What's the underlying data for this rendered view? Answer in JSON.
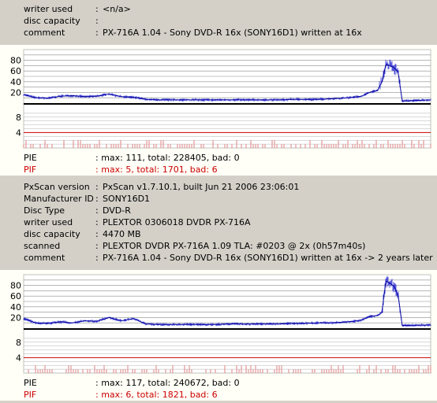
{
  "disc1": {
    "info": [
      {
        "label": "writer used",
        "value": "<n/a>"
      },
      {
        "label": "disc capacity",
        "value": ""
      },
      {
        "label": "comment",
        "value": "PX-716A 1.04 - Sony DVD-R 16x (SONY16D1) written at 16x"
      }
    ],
    "stats": {
      "pie_label": "PIE",
      "pie_value": ": max: 111, total: 228405, bad: 0",
      "pif_label": "PIF",
      "pif_value": ": max: 5, total: 1701, bad: 6"
    }
  },
  "disc2": {
    "info": [
      {
        "label": "PxScan version",
        "value": "PxScan v1.7.10.1, built Jun 21 2006 23:06:01"
      },
      {
        "label": "Manufacturer ID",
        "value": "SONY16D1"
      },
      {
        "label": "Disc Type",
        "value": "DVD-R"
      },
      {
        "label": "writer used",
        "value": "PLEXTOR 0306018 DVDR PX-716A"
      },
      {
        "label": "disc capacity",
        "value": "4470 MB"
      },
      {
        "label": "scanned",
        "value": "PLEXTOR DVDR PX-716A 1.09 TLA: #0203 @ 2x (0h57m40s)"
      },
      {
        "label": "comment",
        "value": "PX-716A 1.04 - Sony DVD-R 16x (SONY16D1) written at 16x -> 2 years later"
      }
    ],
    "stats": {
      "pie_label": "PIE",
      "pie_value": ": max: 117, total: 240672, bad: 0",
      "pif_label": "PIF",
      "pif_value": ": max: 6, total: 1821, bad: 6"
    }
  },
  "separator": ":",
  "colors": {
    "pie": "#2020d0",
    "pif": "#e08080",
    "pif_threshold": "#cc0000",
    "grid": "#8c8c8c"
  },
  "chart_data": [
    {
      "type": "area",
      "title": "",
      "pie": {
        "ylim": [
          0,
          100
        ],
        "yticks": [
          20,
          40,
          60,
          80
        ],
        "tick_labels": [
          "20",
          "40",
          "60",
          "80"
        ],
        "x": [
          0,
          0.03,
          0.06,
          0.09,
          0.12,
          0.15,
          0.18,
          0.21,
          0.24,
          0.27,
          0.3,
          0.33,
          0.36,
          0.39,
          0.42,
          0.45,
          0.48,
          0.51,
          0.54,
          0.57,
          0.6,
          0.63,
          0.66,
          0.69,
          0.72,
          0.75,
          0.78,
          0.81,
          0.83,
          0.85,
          0.87,
          0.88,
          0.89,
          0.9,
          0.91,
          0.92,
          0.93,
          1.0
        ],
        "y": [
          16,
          10,
          9,
          13,
          14,
          12,
          13,
          17,
          12,
          11,
          7,
          6,
          6,
          6,
          6,
          6,
          6,
          6,
          6,
          6,
          6,
          6,
          7,
          7,
          7,
          8,
          9,
          11,
          13,
          20,
          24,
          40,
          72,
          70,
          66,
          58,
          4,
          6
        ]
      },
      "pif": {
        "yticks": [
          4,
          8
        ],
        "tick_labels": [
          "4",
          "8"
        ],
        "threshold": 4,
        "typical": 1
      }
    },
    {
      "type": "area",
      "title": "",
      "pie": {
        "ylim": [
          0,
          100
        ],
        "yticks": [
          20,
          40,
          60,
          80
        ],
        "tick_labels": [
          "20",
          "40",
          "60",
          "80"
        ],
        "x": [
          0,
          0.03,
          0.06,
          0.09,
          0.12,
          0.15,
          0.18,
          0.21,
          0.24,
          0.27,
          0.3,
          0.33,
          0.36,
          0.39,
          0.42,
          0.45,
          0.48,
          0.51,
          0.54,
          0.57,
          0.6,
          0.63,
          0.66,
          0.69,
          0.72,
          0.75,
          0.78,
          0.81,
          0.83,
          0.85,
          0.87,
          0.88,
          0.89,
          0.9,
          0.91,
          0.92,
          0.93,
          1.0
        ],
        "y": [
          18,
          10,
          9,
          12,
          10,
          14,
          13,
          20,
          14,
          18,
          8,
          7,
          7,
          7,
          7,
          7,
          7,
          8,
          8,
          8,
          8,
          8,
          9,
          9,
          10,
          10,
          11,
          13,
          15,
          22,
          24,
          30,
          88,
          84,
          78,
          62,
          5,
          6
        ]
      },
      "pif": {
        "yticks": [
          4,
          8
        ],
        "tick_labels": [
          "4",
          "8"
        ],
        "threshold": 4,
        "typical": 1
      }
    }
  ]
}
